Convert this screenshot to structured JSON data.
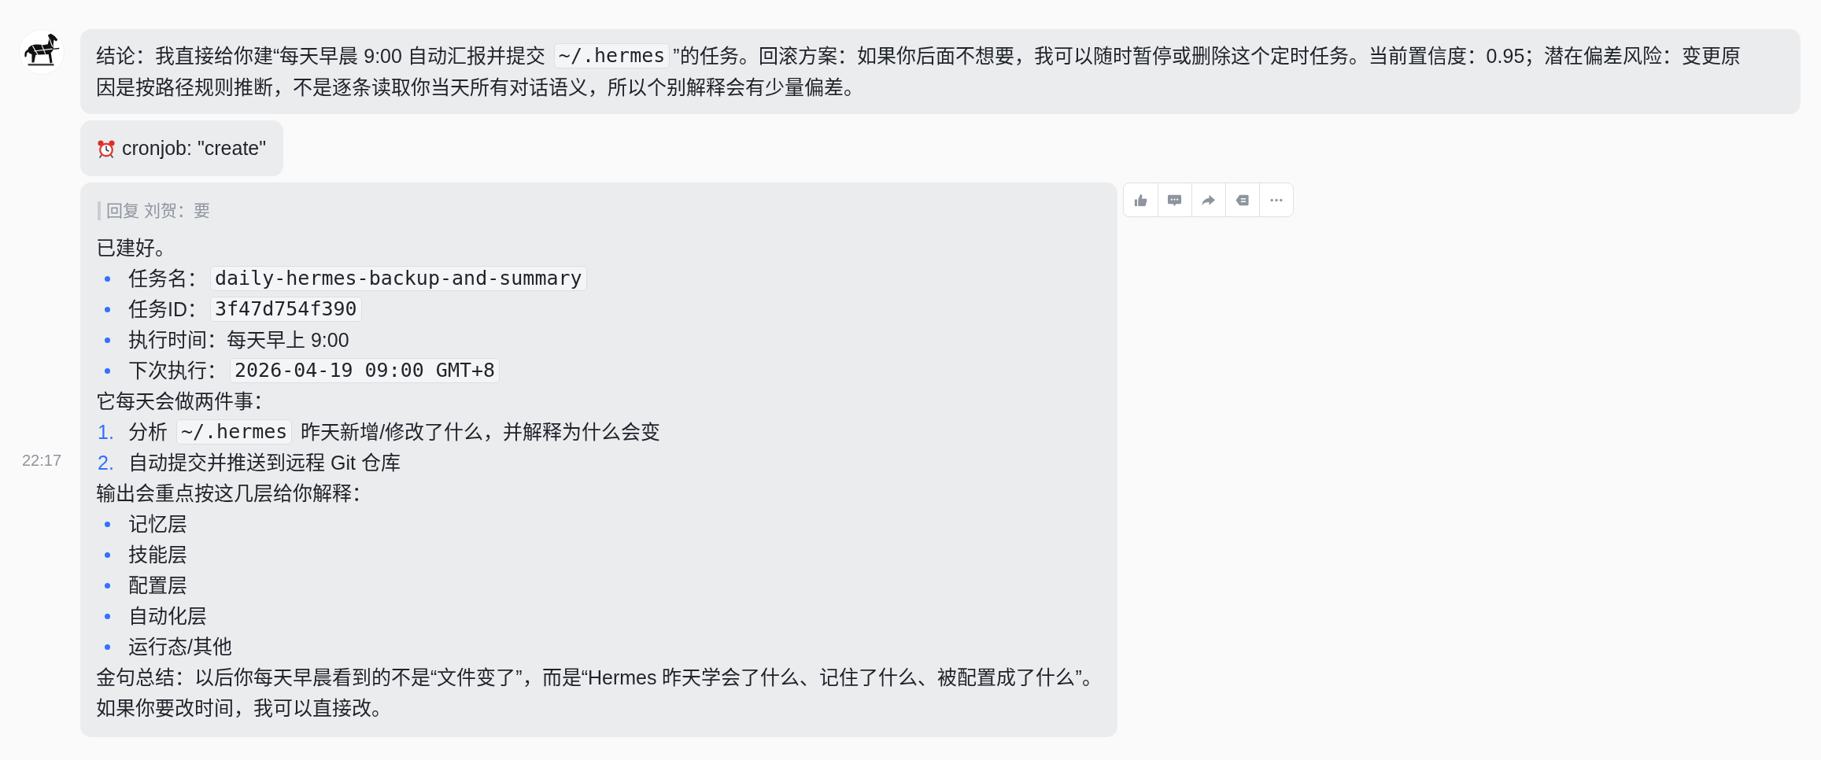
{
  "message_group": {
    "messages": [
      {
        "kind": "text",
        "hovered": false,
        "blocks": [
          {
            "kind": "paragraph",
            "segments": [
              {
                "kind": "text",
                "text": "结论：我直接给你建“每天早晨 9:00 自动汇报并提交 "
              },
              {
                "kind": "code",
                "text": "~/.hermes"
              },
              {
                "kind": "text",
                "text": "”的任务。回滚方案：如果你后面不想要，我可以随时暂停或删除这个定时任务。当前置信度：0.95；潜在偏差风险：变更原因是按路径规则推断，不是逐条读取你当天所有对话语义，所以个别解释会有少量偏差。"
              }
            ]
          }
        ]
      },
      {
        "kind": "tool_call",
        "hovered": false,
        "text": "cronjob: \"create\""
      },
      {
        "kind": "reply",
        "hovered": true,
        "time": "22:17",
        "quote": "回复 刘贺：要",
        "blocks": [
          {
            "kind": "paragraph",
            "segments": [
              {
                "kind": "text",
                "text": "已建好。"
              }
            ]
          },
          {
            "kind": "bullet_list",
            "items": [
              {
                "segments": [
                  {
                    "kind": "text",
                    "text": "任务名："
                  },
                  {
                    "kind": "code",
                    "text": "daily-hermes-backup-and-summary"
                  }
                ]
              },
              {
                "segments": [
                  {
                    "kind": "text",
                    "text": "任务ID："
                  },
                  {
                    "kind": "code",
                    "text": "3f47d754f390"
                  }
                ]
              },
              {
                "segments": [
                  {
                    "kind": "text",
                    "text": "执行时间：每天早上 9:00"
                  }
                ]
              },
              {
                "segments": [
                  {
                    "kind": "text",
                    "text": "下次执行："
                  },
                  {
                    "kind": "code",
                    "text": "2026-04-19 09:00 GMT+8"
                  }
                ]
              }
            ]
          },
          {
            "kind": "paragraph",
            "segments": [
              {
                "kind": "text",
                "text": "它每天会做两件事："
              }
            ]
          },
          {
            "kind": "numbered_list",
            "items": [
              {
                "marker": "1.",
                "segments": [
                  {
                    "kind": "text",
                    "text": "分析 "
                  },
                  {
                    "kind": "code",
                    "text": "~/.hermes"
                  },
                  {
                    "kind": "text",
                    "text": " 昨天新增/修改了什么，并解释为什么会变"
                  }
                ]
              },
              {
                "marker": "2.",
                "segments": [
                  {
                    "kind": "text",
                    "text": "自动提交并推送到远程 Git 仓库"
                  }
                ]
              }
            ]
          },
          {
            "kind": "paragraph",
            "segments": [
              {
                "kind": "text",
                "text": "输出会重点按这几层给你解释："
              }
            ]
          },
          {
            "kind": "bullet_list",
            "items": [
              {
                "segments": [
                  {
                    "kind": "text",
                    "text": "记忆层"
                  }
                ]
              },
              {
                "segments": [
                  {
                    "kind": "text",
                    "text": "技能层"
                  }
                ]
              },
              {
                "segments": [
                  {
                    "kind": "text",
                    "text": "配置层"
                  }
                ]
              },
              {
                "segments": [
                  {
                    "kind": "text",
                    "text": "自动化层"
                  }
                ]
              },
              {
                "segments": [
                  {
                    "kind": "text",
                    "text": "运行态/其他"
                  }
                ]
              }
            ]
          },
          {
            "kind": "paragraph",
            "segments": [
              {
                "kind": "text",
                "text": "金句总结：以后你每天早晨看到的不是“文件变了”，而是“Hermes 昨天学会了什么、记住了什么、被配置成了什么”。"
              }
            ]
          },
          {
            "kind": "paragraph",
            "segments": [
              {
                "kind": "text",
                "text": "如果你要改时间，我可以直接改。"
              }
            ]
          }
        ]
      }
    ]
  }
}
